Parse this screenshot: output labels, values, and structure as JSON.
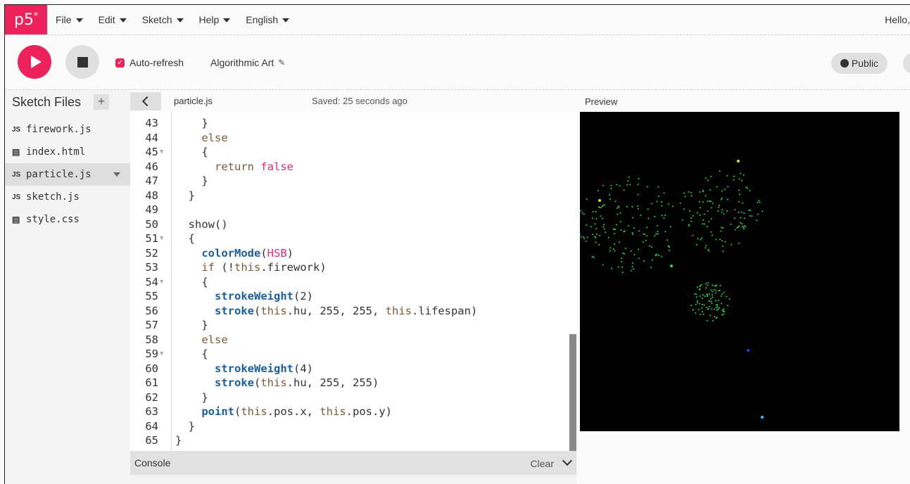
{
  "nav": {
    "logo": "p5",
    "logo_sup": "*",
    "menu": [
      {
        "label": "File"
      },
      {
        "label": "Edit"
      },
      {
        "label": "Sketch"
      },
      {
        "label": "Help"
      },
      {
        "label": "English"
      }
    ],
    "greeting": "Hello,"
  },
  "toolbar": {
    "auto_refresh_label": "Auto-refresh",
    "auto_refresh_checked": true,
    "sketch_name": "Algorithmic Art",
    "public_label": "Public",
    "accent_color": "#ed225d"
  },
  "sidebar": {
    "title": "Sketch Files",
    "files": [
      {
        "icon": "JS",
        "name": "firework.js",
        "active": false
      },
      {
        "icon": "html",
        "name": "index.html",
        "active": false
      },
      {
        "icon": "JS",
        "name": "particle.js",
        "active": true
      },
      {
        "icon": "JS",
        "name": "sketch.js",
        "active": false
      },
      {
        "icon": "css",
        "name": "style.css",
        "active": false
      }
    ]
  },
  "editor": {
    "tab_name": "particle.js",
    "saved_status": "Saved: 25 seconds ago",
    "lines": [
      {
        "n": "43",
        "fold": false,
        "tokens": [
          {
            "t": "    }",
            "c": ""
          }
        ]
      },
      {
        "n": "44",
        "fold": false,
        "tokens": [
          {
            "t": "    ",
            "c": ""
          },
          {
            "t": "else",
            "c": "kw"
          }
        ]
      },
      {
        "n": "45",
        "fold": true,
        "tokens": [
          {
            "t": "    {",
            "c": ""
          }
        ]
      },
      {
        "n": "46",
        "fold": false,
        "tokens": [
          {
            "t": "      ",
            "c": ""
          },
          {
            "t": "return",
            "c": "kw"
          },
          {
            "t": " ",
            "c": ""
          },
          {
            "t": "false",
            "c": "pk"
          }
        ]
      },
      {
        "n": "47",
        "fold": false,
        "tokens": [
          {
            "t": "    }",
            "c": ""
          }
        ]
      },
      {
        "n": "48",
        "fold": false,
        "tokens": [
          {
            "t": "  }",
            "c": ""
          }
        ]
      },
      {
        "n": "49",
        "fold": false,
        "tokens": [
          {
            "t": "",
            "c": ""
          }
        ]
      },
      {
        "n": "50",
        "fold": false,
        "tokens": [
          {
            "t": "  show()",
            "c": ""
          }
        ]
      },
      {
        "n": "51",
        "fold": true,
        "tokens": [
          {
            "t": "  {",
            "c": ""
          }
        ]
      },
      {
        "n": "52",
        "fold": false,
        "tokens": [
          {
            "t": "    ",
            "c": ""
          },
          {
            "t": "colorMode",
            "c": "fn"
          },
          {
            "t": "(",
            "c": ""
          },
          {
            "t": "HSB",
            "c": "pk"
          },
          {
            "t": ")",
            "c": ""
          }
        ]
      },
      {
        "n": "53",
        "fold": false,
        "tokens": [
          {
            "t": "    ",
            "c": ""
          },
          {
            "t": "if",
            "c": "kw"
          },
          {
            "t": " (!",
            "c": ""
          },
          {
            "t": "this",
            "c": "kw"
          },
          {
            "t": ".firework)",
            "c": ""
          }
        ]
      },
      {
        "n": "54",
        "fold": true,
        "tokens": [
          {
            "t": "    {",
            "c": ""
          }
        ]
      },
      {
        "n": "55",
        "fold": false,
        "tokens": [
          {
            "t": "      ",
            "c": ""
          },
          {
            "t": "strokeWeight",
            "c": "fn"
          },
          {
            "t": "(2)",
            "c": ""
          }
        ]
      },
      {
        "n": "56",
        "fold": false,
        "tokens": [
          {
            "t": "      ",
            "c": ""
          },
          {
            "t": "stroke",
            "c": "fn"
          },
          {
            "t": "(",
            "c": ""
          },
          {
            "t": "this",
            "c": "kw"
          },
          {
            "t": ".hu, 255, 255, ",
            "c": ""
          },
          {
            "t": "this",
            "c": "kw"
          },
          {
            "t": ".lifespan)",
            "c": ""
          }
        ]
      },
      {
        "n": "57",
        "fold": false,
        "tokens": [
          {
            "t": "    }",
            "c": ""
          }
        ]
      },
      {
        "n": "58",
        "fold": false,
        "tokens": [
          {
            "t": "    ",
            "c": ""
          },
          {
            "t": "else",
            "c": "kw"
          }
        ]
      },
      {
        "n": "59",
        "fold": true,
        "tokens": [
          {
            "t": "    {",
            "c": ""
          }
        ]
      },
      {
        "n": "60",
        "fold": false,
        "tokens": [
          {
            "t": "      ",
            "c": ""
          },
          {
            "t": "strokeWeight",
            "c": "fn"
          },
          {
            "t": "(4)",
            "c": ""
          }
        ]
      },
      {
        "n": "61",
        "fold": false,
        "tokens": [
          {
            "t": "      ",
            "c": ""
          },
          {
            "t": "stroke",
            "c": "fn"
          },
          {
            "t": "(",
            "c": ""
          },
          {
            "t": "this",
            "c": "kw"
          },
          {
            "t": ".hu, 255, 255)",
            "c": ""
          }
        ]
      },
      {
        "n": "62",
        "fold": false,
        "tokens": [
          {
            "t": "    }",
            "c": ""
          }
        ]
      },
      {
        "n": "63",
        "fold": false,
        "tokens": [
          {
            "t": "    ",
            "c": ""
          },
          {
            "t": "point",
            "c": "fn"
          },
          {
            "t": "(",
            "c": ""
          },
          {
            "t": "this",
            "c": "kw"
          },
          {
            "t": ".pos.x, ",
            "c": ""
          },
          {
            "t": "this",
            "c": "kw"
          },
          {
            "t": ".pos.y)",
            "c": ""
          }
        ]
      },
      {
        "n": "64",
        "fold": false,
        "tokens": [
          {
            "t": "  }",
            "c": ""
          }
        ]
      },
      {
        "n": "65",
        "fold": false,
        "tokens": [
          {
            "t": "}",
            "c": ""
          }
        ]
      }
    ]
  },
  "console": {
    "label": "Console",
    "clear_label": "Clear"
  },
  "preview": {
    "label": "Preview",
    "background": "#000000",
    "particle_colors": [
      "#22dd44",
      "#ccee22",
      "#1144ff",
      "#22ccff"
    ]
  }
}
